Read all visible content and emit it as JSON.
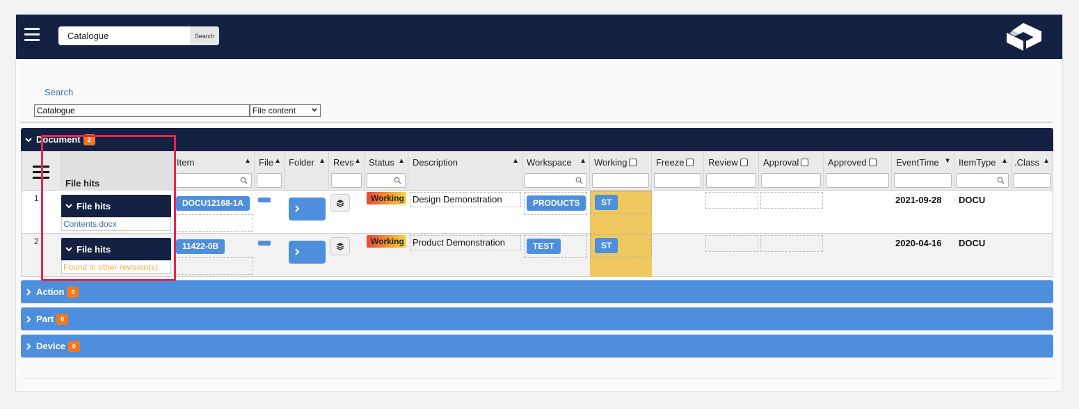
{
  "topbar": {
    "search_value": "Catalogue",
    "search_button": "Search"
  },
  "search_panel": {
    "link_label": "Search",
    "query_value": "Catalogue",
    "mode_selected": "File content"
  },
  "document_section": {
    "title": "Document",
    "count": "2",
    "columns": {
      "file_hits": "File hits",
      "item": "Item",
      "file": "File",
      "folder": "Folder",
      "revs": "Revs",
      "status": "Status",
      "description": "Description",
      "workspace": "Workspace",
      "working": "Working",
      "freeze": "Freeze",
      "review": "Review",
      "approval": "Approval",
      "approved": "Approved",
      "event_time": "EventTime",
      "item_type": "ItemType",
      "class": ".Class"
    },
    "rows": [
      {
        "num": "1",
        "file_hits_label": "File hits",
        "file_hits_value": "Contents.docx",
        "item": "DOCU12168-1A",
        "status": "Working",
        "description": "Design Demonstration",
        "workspace": "PRODUCTS",
        "working": "ST",
        "event_time": "2021-09-28",
        "item_type": "DOCU"
      },
      {
        "num": "2",
        "file_hits_label": "File hits",
        "file_hits_value": "Found in other revision(s).",
        "item": "11422-0B",
        "status": "Working",
        "description": "Product Demonstration",
        "workspace": "TEST",
        "working": "ST",
        "event_time": "2020-04-16",
        "item_type": "DOCU"
      }
    ]
  },
  "collapsed_sections": [
    {
      "title": "Action",
      "count": "0"
    },
    {
      "title": "Part",
      "count": "0"
    },
    {
      "title": "Device",
      "count": "0"
    }
  ],
  "colors": {
    "navy": "#152142",
    "accent_blue": "#4d8fdc",
    "badge_orange": "#f07820",
    "working_highlight": "#f0c860",
    "annotation_red": "#e8254f"
  }
}
